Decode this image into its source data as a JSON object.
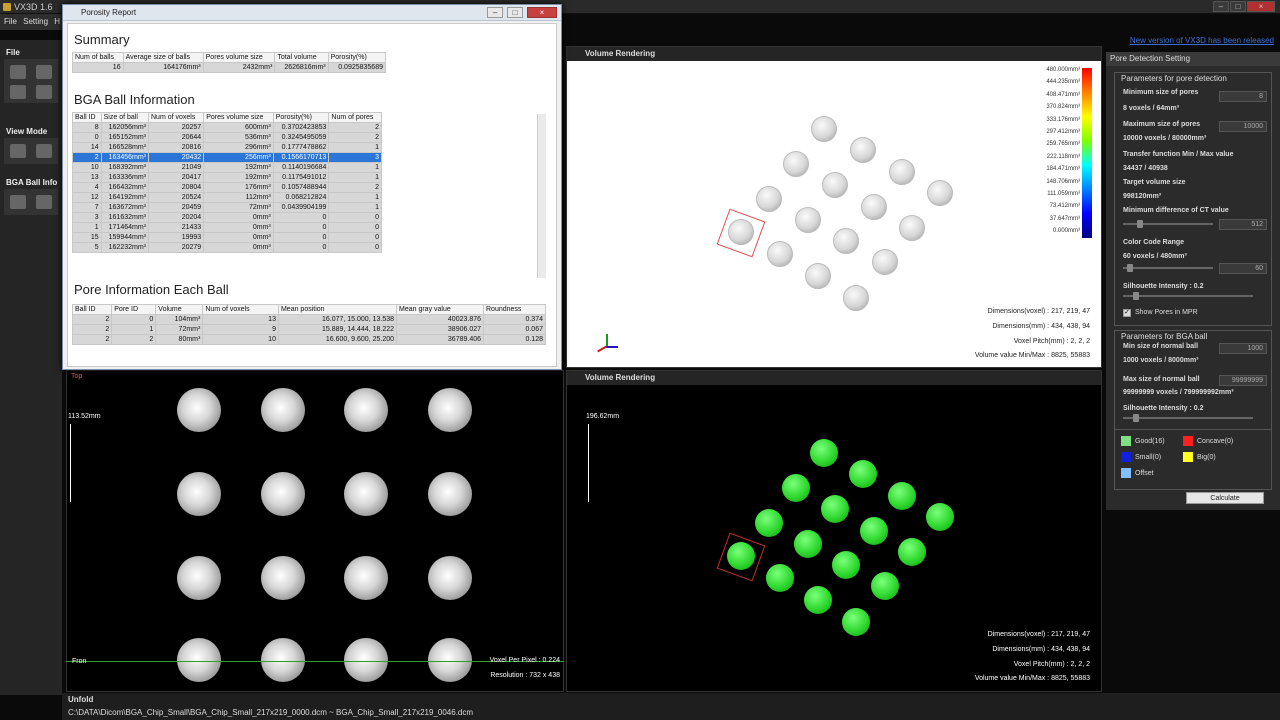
{
  "app": {
    "title": "VX3D 1.6",
    "new_version": "New version of VX3D has been released"
  },
  "menu": [
    "File",
    "Setting",
    "H"
  ],
  "left_panel": {
    "file_label": "File",
    "view_mode_label": "View Mode",
    "bga_label": "BGA Ball Info"
  },
  "report": {
    "title": "Porosity Report",
    "summary_title": "Summary",
    "summary_headers": [
      "Num of balls",
      "Average size of balls",
      "Pores volume size",
      "Total volume",
      "Porosity(%)"
    ],
    "summary_row": [
      "16",
      "164176mm³",
      "2432mm³",
      "2626816mm³",
      "0.0925835689"
    ],
    "bga_title": "BGA Ball Information",
    "bga_headers": [
      "Ball ID",
      "Size of ball",
      "Num of voxels",
      "Pores volume size",
      "Porosity(%)",
      "Num of pores"
    ],
    "bga_rows": [
      [
        "8",
        "162056mm³",
        "20257",
        "600mm³",
        "0.3702423853",
        "2"
      ],
      [
        "0",
        "165152mm³",
        "20644",
        "536mm³",
        "0.3245495059",
        "2"
      ],
      [
        "14",
        "166528mm³",
        "20816",
        "296mm³",
        "0.1777478862",
        "1"
      ],
      [
        "2",
        "163456mm³",
        "20432",
        "256mm³",
        "0.1566170713",
        "3"
      ],
      [
        "10",
        "168392mm³",
        "21049",
        "192mm³",
        "0.1140196684",
        "1"
      ],
      [
        "13",
        "163336mm³",
        "20417",
        "192mm³",
        "0.1175491012",
        "1"
      ],
      [
        "4",
        "166432mm³",
        "20804",
        "176mm³",
        "0.1057488944",
        "2"
      ],
      [
        "12",
        "164192mm³",
        "20524",
        "112mm³",
        "0.068212824",
        "1"
      ],
      [
        "7",
        "163672mm³",
        "20459",
        "72mm³",
        "0.0439904199",
        "1"
      ],
      [
        "3",
        "161632mm³",
        "20204",
        "0mm³",
        "0",
        "0"
      ],
      [
        "1",
        "171464mm³",
        "21433",
        "0mm³",
        "0",
        "0"
      ],
      [
        "15",
        "159944mm³",
        "19993",
        "0mm³",
        "0",
        "0"
      ],
      [
        "5",
        "162232mm³",
        "20279",
        "0mm³",
        "0",
        "0"
      ]
    ],
    "selected_row": 3,
    "pore_title": "Pore Information Each Ball",
    "pore_headers": [
      "Ball ID",
      "Pore ID",
      "Volume",
      "Num of voxels",
      "Mean position",
      "Mean gray value",
      "Roundness"
    ],
    "pore_rows": [
      [
        "2",
        "0",
        "104mm³",
        "13",
        "16.077,    15.000,    13.538",
        "40023.876",
        "0.374"
      ],
      [
        "2",
        "1",
        "72mm³",
        "9",
        "15.889,    14.444,    18.222",
        "38906.027",
        "0.067"
      ],
      [
        "2",
        "2",
        "80mm³",
        "10",
        "16.600,      9.600,    25.200",
        "36789.406",
        "0.128"
      ]
    ]
  },
  "volume_top": {
    "title": "Volume Rendering",
    "colorbar": [
      "480.000mm³",
      "444.235mm³",
      "408.471mm³",
      "370.824mm³",
      "333.176mm³",
      "297.412mm³",
      "259.765mm³",
      "222.118mm³",
      "184.471mm³",
      "148.706mm³",
      "111.059mm³",
      "73.412mm³",
      "37.647mm³",
      "0.000mm³"
    ],
    "info": [
      "Dimensions(voxel) : 217, 219, 47",
      "Dimensions(mm) : 434, 438, 94",
      "Voxel Pitch(mm) : 2, 2, 2",
      "Volume value Min/Max : 8825, 55883"
    ]
  },
  "volume_bottom": {
    "title": "Volume Rendering",
    "scale": "196.62mm",
    "info": [
      "Dimensions(voxel) : 217, 219, 47",
      "Dimensions(mm) : 434, 438, 94",
      "Voxel Pitch(mm) : 2, 2, 2",
      "Volume value Min/Max : 8825, 55883"
    ]
  },
  "ct_view": {
    "label": "Top",
    "scale": "113.52mm",
    "front": "Fron",
    "voxel_per_pixel": "Voxel Per Pixel : 0.224",
    "resolution": "Resolution : 732 x 438"
  },
  "pore_settings": {
    "title": "Pore Detection Setting",
    "pore_group": "Parameters for pore detection",
    "min_size_label": "Minimum size of pores",
    "min_size_value": "8",
    "min_size_info": "8 voxels / 64mm³",
    "max_size_label": "Maximum size of pores",
    "max_size_value": "10000",
    "max_size_info": "10000 voxels / 80000mm³",
    "tf_label": "Transfer function Min / Max value",
    "tf_value": "34437 / 40938",
    "target_label": "Target volume size",
    "target_value": "998120mm³",
    "min_diff_label": "Minimum difference of CT value",
    "min_diff_value": "512",
    "color_range_label": "Color Code Range",
    "color_range_info": "60 voxels / 480mm³",
    "color_range_value": "60",
    "silhouette_label": "Silhouette Intensity : 0.2",
    "show_pores_label": "Show Pores in MPR",
    "bga_group": "Parameters for BGA ball",
    "min_normal_label": "Min size of normal ball",
    "min_normal_value": "1000",
    "min_normal_info": "1000 voxels / 8000mm³",
    "max_normal_label": "Max size of normal ball",
    "max_normal_value": "99999999",
    "max_normal_info": "99999999 voxels / 799999992mm³",
    "silhouette2_label": "Silhouette Intensity : 0.2",
    "legend": [
      {
        "label": "Good(16)",
        "color": "#7fe07f"
      },
      {
        "label": "Concave(0)",
        "color": "#ff2020"
      },
      {
        "label": "Small(0)",
        "color": "#1020e0"
      },
      {
        "label": "Big(0)",
        "color": "#ffff20"
      },
      {
        "label": "Offset",
        "color": "#80c0ff"
      }
    ],
    "calculate_label": "Calculate"
  },
  "status": {
    "unfold": "Unfold",
    "path": "C:\\DATA\\Dicom\\BGA_Chip_Small\\BGA_Chip_Small_217x219_0000.dcm ~ BGA_Chip_Small_217x219_0046.dcm"
  }
}
